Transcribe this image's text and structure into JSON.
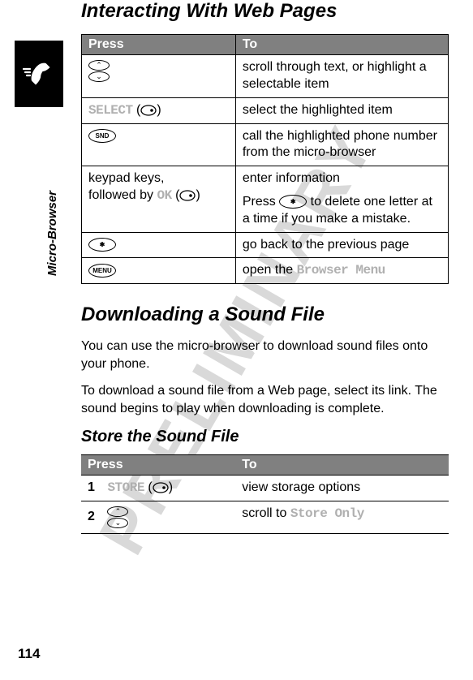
{
  "watermark": "PRELIMINARY",
  "sidebar_label": "Micro-Browser",
  "page_number": "114",
  "heading_interact": "Interacting With Web Pages",
  "table1": {
    "header_press": "Press",
    "header_to": "To",
    "rows": [
      {
        "to": "scroll through text, or highlight a selectable item"
      },
      {
        "press_prefix": "SELECT",
        "press_suffix_open": " (",
        "press_suffix_close": ")",
        "to": "select the highlighted item"
      },
      {
        "press_key_label": "SND",
        "to": "call the highlighted phone number from the micro-browser"
      },
      {
        "press_text_a": "keypad keys,",
        "press_text_b": "followed by ",
        "press_ok": "OK",
        "press_text_c": " (",
        "press_text_d": ")",
        "to_a": "enter information",
        "to_b_pre": "Press ",
        "to_b_post": " to delete one letter at a time if you make a mistake."
      },
      {
        "press_key_label": "*",
        "to": "go back to the previous page"
      },
      {
        "press_key_label": "MENU",
        "to_pre": "open the ",
        "to_mono": "Browser Menu"
      }
    ]
  },
  "heading_download": "Downloading a Sound File",
  "download_p1": "You can use the micro-browser to download sound files onto your phone.",
  "download_p2": "To download a sound file from a Web page, select its link. The sound begins to play when downloading is complete.",
  "heading_store": "Store the Sound File",
  "table2": {
    "header_press": "Press",
    "header_to": "To",
    "rows": [
      {
        "num": "1",
        "press_prefix": "STORE",
        "to": "view storage options"
      },
      {
        "num": "2",
        "to_pre": "scroll to ",
        "to_mono": "Store Only"
      }
    ]
  }
}
